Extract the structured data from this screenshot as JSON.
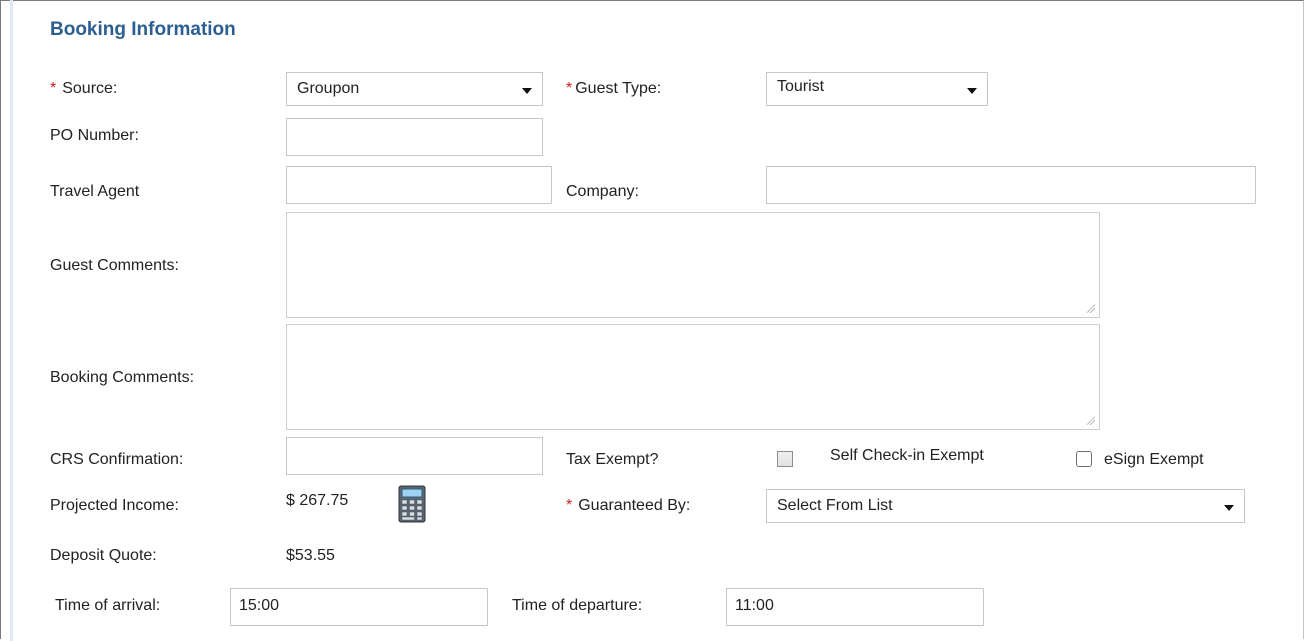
{
  "section": {
    "title": "Booking Information"
  },
  "required_mark": "*",
  "source": {
    "label": "Source:",
    "value": "Groupon"
  },
  "guest_type": {
    "label": "Guest Type:",
    "value": "Tourist"
  },
  "po_number": {
    "label": "PO Number:",
    "value": ""
  },
  "travel_agent": {
    "label": "Travel Agent",
    "value": ""
  },
  "company": {
    "label": "Company:",
    "value": ""
  },
  "guest_comments": {
    "label": "Guest Comments:",
    "value": ""
  },
  "booking_comments": {
    "label": "Booking Comments:",
    "value": ""
  },
  "crs_confirmation": {
    "label": "CRS Confirmation:",
    "value": ""
  },
  "tax_exempt": {
    "label": "Tax Exempt?",
    "checked": false
  },
  "self_checkin_exempt": {
    "label": "Self Check-in Exempt",
    "checked": false
  },
  "esign_exempt": {
    "label": "eSign Exempt",
    "checked": false
  },
  "projected_income": {
    "label": "Projected Income:",
    "value": "$ 267.75",
    "icon": "calculator-icon"
  },
  "guaranteed_by": {
    "label": "Guaranteed By:",
    "value": "Select From List"
  },
  "deposit_quote": {
    "label": "Deposit Quote:",
    "value": "$53.55"
  },
  "time_of_arrival": {
    "label": "Time of arrival:",
    "value": "15:00"
  },
  "time_of_departure": {
    "label": "Time of departure:",
    "value": "11:00"
  },
  "colors": {
    "title": "#2b5f91",
    "required": "#d21e1e",
    "border": "#c7c7c7"
  }
}
